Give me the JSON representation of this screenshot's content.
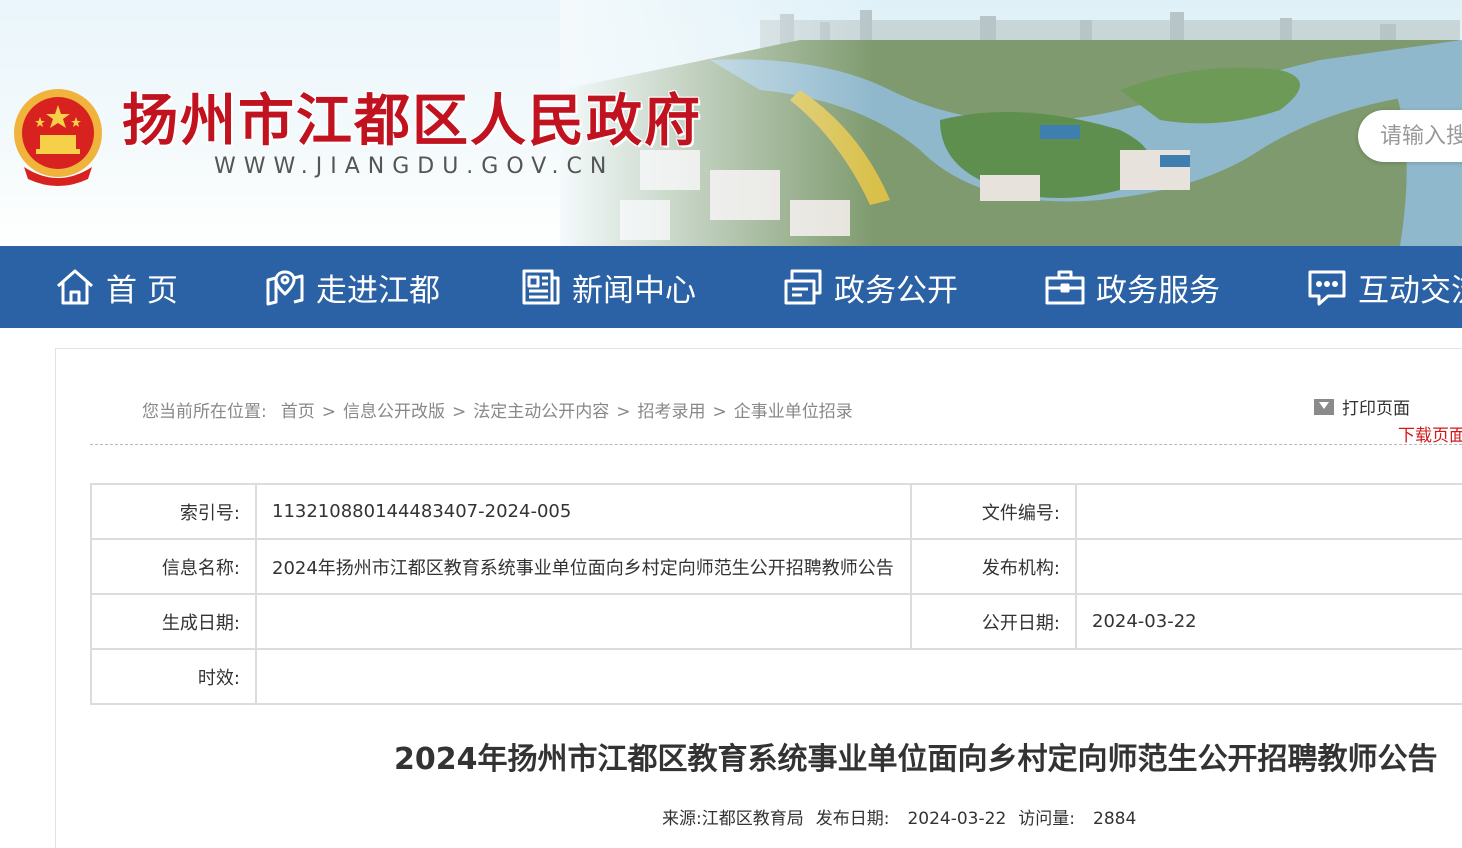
{
  "header": {
    "site_title": "扬州市江都区人民政府",
    "site_url": "WWW.JIANGDU.GOV.CN",
    "search_placeholder": "请输入搜索内容"
  },
  "nav": {
    "items": [
      {
        "label": "首 页",
        "icon": "home-icon"
      },
      {
        "label": "走进江都",
        "icon": "map-pin-icon"
      },
      {
        "label": "新闻中心",
        "icon": "newspaper-icon"
      },
      {
        "label": "政务公开",
        "icon": "document-icon"
      },
      {
        "label": "政务服务",
        "icon": "briefcase-icon"
      },
      {
        "label": "互动交流",
        "icon": "chat-icon"
      }
    ]
  },
  "breadcrumb": {
    "lead": "您当前所在位置:",
    "items": [
      "首页",
      "信息公开改版",
      "法定主动公开内容",
      "招考录用",
      "企事业单位招录"
    ],
    "separator": ">"
  },
  "tools": {
    "print_label": "打印页面",
    "download_label": "下载页面"
  },
  "info": {
    "index_label": "索引号:",
    "index_value": "113210880144483407-2024-005",
    "doc_no_label": "文件编号:",
    "doc_no_value": "",
    "name_label": "信息名称:",
    "name_value": "2024年扬州市江都区教育系统事业单位面向乡村定向师范生公开招聘教师公告",
    "publisher_label": "发布机构:",
    "publisher_value": "",
    "created_label": "生成日期:",
    "created_value": "",
    "public_label": "公开日期:",
    "public_value": "2024-03-22",
    "validity_label": "时效:",
    "validity_value": ""
  },
  "article": {
    "title": "2024年扬州市江都区教育系统事业单位面向乡村定向师范生公开招聘教师公告",
    "source_label": "来源:",
    "source_value": "江都区教育局",
    "date_label": "发布日期:",
    "date_value": "2024-03-22",
    "views_label": "访问量:",
    "views_value": "2884"
  },
  "colors": {
    "nav_bg": "#2b61a5",
    "title_red": "#c1121f",
    "download_red": "#d11a1a"
  }
}
